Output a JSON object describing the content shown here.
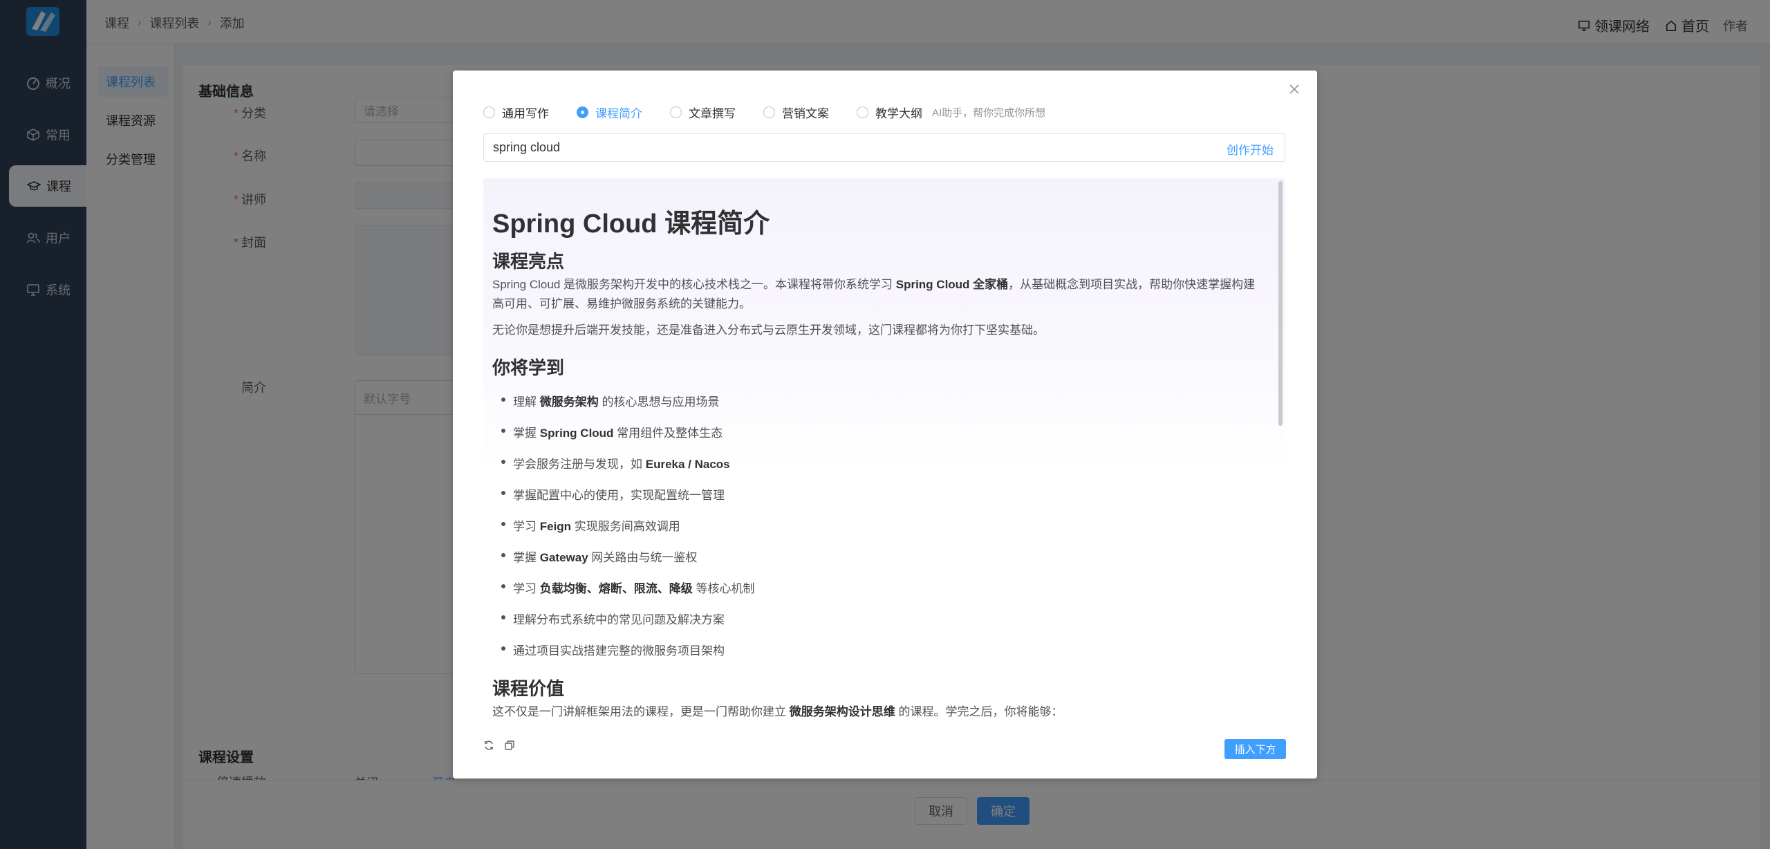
{
  "sidebar": {
    "items": [
      {
        "label": "概况",
        "icon": "dashboard-icon"
      },
      {
        "label": "常用",
        "icon": "cube-icon"
      },
      {
        "label": "课程",
        "icon": "graduation-cap-icon"
      },
      {
        "label": "用户",
        "icon": "users-icon"
      },
      {
        "label": "系统",
        "icon": "monitor-icon"
      }
    ],
    "active_index": 2
  },
  "header": {
    "breadcrumb": [
      "课程",
      "课程列表",
      "添加"
    ],
    "network_link": "领课网络",
    "home_link": "首页",
    "author": "作者"
  },
  "submenu": {
    "items": [
      "课程列表",
      "课程资源",
      "分类管理"
    ],
    "active_index": 0
  },
  "form": {
    "section_basic": "基础信息",
    "category_label": "分类",
    "category_placeholder": "请选择",
    "name_label": "名称",
    "lecturer_label": "讲师",
    "cover_label": "封面",
    "intro_label": "简介",
    "font_size_placeholder": "默认字号",
    "section_settings": "课程设置",
    "speed_label": "倍速播放",
    "speed_off": "关闭",
    "speed_on": "开启"
  },
  "footer": {
    "cancel": "取消",
    "confirm": "确定"
  },
  "dialog": {
    "modes": [
      "通用写作",
      "课程简介",
      "文章撰写",
      "营销文案",
      "教学大纲"
    ],
    "selected_mode": 1,
    "hint": "AI助手，帮你完成你所想",
    "prompt_value": "spring cloud",
    "start_button": "创作开始",
    "insert_button": "插入下方",
    "result": {
      "title": "Spring Cloud 课程简介",
      "h_highlights": "课程亮点",
      "p1_a": "Spring Cloud 是微服务架构开发中的核心技术栈之一。本课程将带你系统学习 ",
      "p1_b": "Spring Cloud 全家桶",
      "p1_c": "，从基础概念到项目实战，帮助你快速掌握构建高可用、可扩展、易维护微服务系统的关键能力。",
      "p2": "无论你是想提升后端开发技能，还是准备进入分布式与云原生开发领域，这门课程都将为你打下坚实基础。",
      "h_learn": "你将学到",
      "list": [
        {
          "pre": "理解 ",
          "bold": "微服务架构",
          "post": " 的核心思想与应用场景"
        },
        {
          "pre": "掌握 ",
          "bold": "Spring Cloud",
          "post": " 常用组件及整体生态"
        },
        {
          "pre": "学会服务注册与发现，如 ",
          "bold": "Eureka / Nacos",
          "post": ""
        },
        {
          "pre": "掌握配置中心的使用，实现配置统一管理",
          "bold": "",
          "post": ""
        },
        {
          "pre": "学习 ",
          "bold": "Feign",
          "post": " 实现服务间高效调用"
        },
        {
          "pre": "掌握 ",
          "bold": "Gateway",
          "post": " 网关路由与统一鉴权"
        },
        {
          "pre": "学习 ",
          "bold": "负载均衡、熔断、限流、降级",
          "post": " 等核心机制"
        },
        {
          "pre": "理解分布式系统中的常见问题及解决方案",
          "bold": "",
          "post": ""
        },
        {
          "pre": "通过项目实战搭建完整的微服务项目架构",
          "bold": "",
          "post": ""
        }
      ],
      "h_value": "课程价值",
      "p3_a": "这不仅是一门讲解框架用法的课程，更是一门帮助你建立 ",
      "p3_b": "微服务架构设计思维",
      "p3_c": " 的课程。学完之后，你将能够："
    }
  },
  "colors": {
    "sidebar_bg": "#304156",
    "primary": "#409eff",
    "required": "#f56c6c"
  }
}
